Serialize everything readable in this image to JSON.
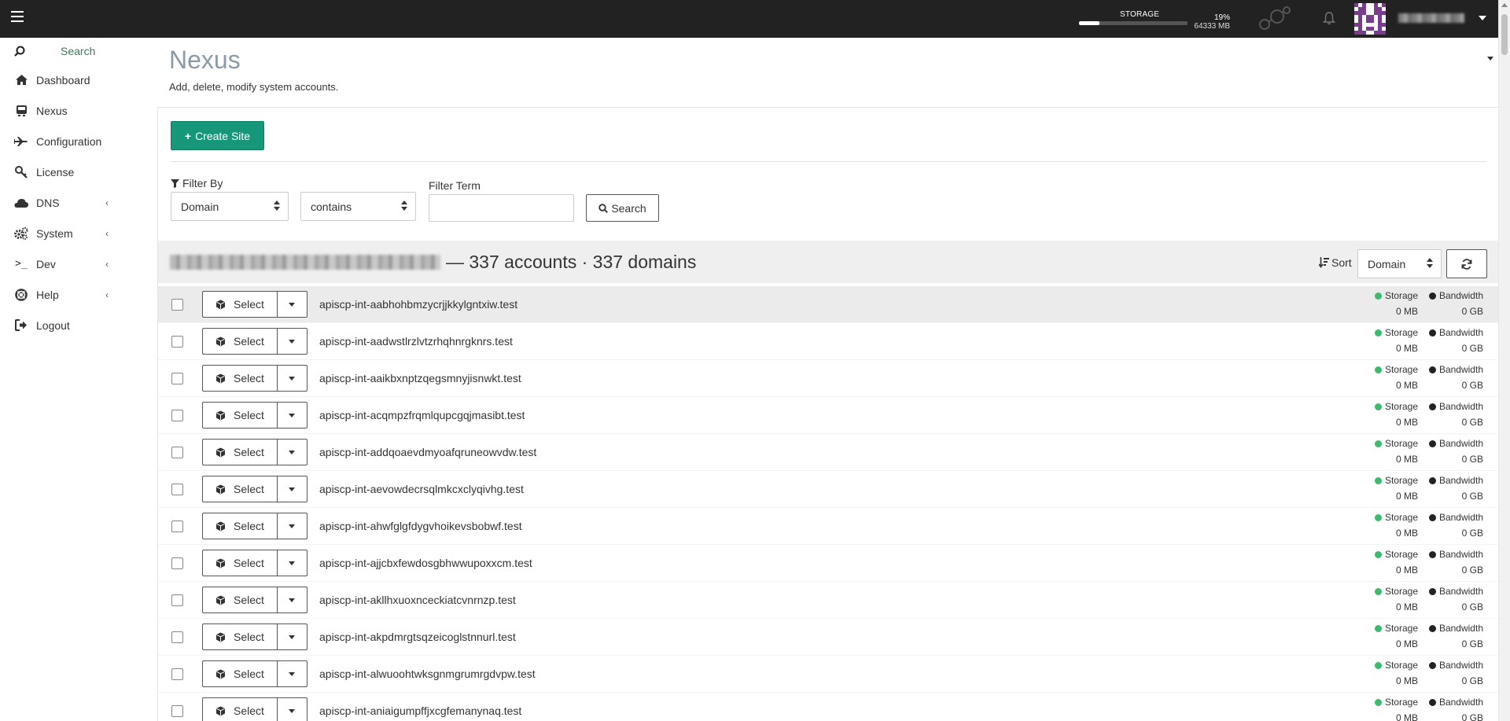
{
  "topbar": {
    "storage_label": "STORAGE",
    "storage_percent_text": "19%",
    "storage_used_text": "64333 MB",
    "storage_fraction": 0.19,
    "menu_icon": "hamburger-icon",
    "notifications_icon": "bell-icon"
  },
  "sidebar": {
    "search_label": "Search",
    "items": [
      {
        "label": "Dashboard",
        "icon": "home-icon",
        "expandable": false
      },
      {
        "label": "Nexus",
        "icon": "server-icon",
        "expandable": false
      },
      {
        "label": "Configuration",
        "icon": "plane-icon",
        "expandable": false
      },
      {
        "label": "License",
        "icon": "key-icon",
        "expandable": false
      },
      {
        "label": "DNS",
        "icon": "cloud-icon",
        "expandable": true
      },
      {
        "label": "System",
        "icon": "gears-icon",
        "expandable": true
      },
      {
        "label": "Dev",
        "icon": "terminal-icon",
        "expandable": true
      },
      {
        "label": "Help",
        "icon": "lifebuoy-icon",
        "expandable": true
      },
      {
        "label": "Logout",
        "icon": "sign-out-icon",
        "expandable": false
      }
    ]
  },
  "header": {
    "title": "Nexus",
    "subtitle": "Add, delete, modify system accounts."
  },
  "toolbar": {
    "create_label": "Create Site"
  },
  "filter": {
    "by_label": "Filter By",
    "field_value": "Domain",
    "op_value": "contains",
    "term_label": "Filter Term",
    "term_value": "",
    "search_label": "Search"
  },
  "summary": {
    "text": "— 337 accounts · 337 domains",
    "sort_label": "Sort",
    "sort_value": "Domain"
  },
  "metrics": {
    "storage_label": "Storage",
    "bandwidth_label": "Bandwidth",
    "storage_color": "#3cba6d",
    "bandwidth_color": "#222222"
  },
  "accounts": [
    {
      "domain": "apiscp-int-aabhohbmzycrjjkkylgntxiw.test",
      "storage": "0 MB",
      "bandwidth": "0 GB",
      "select_label": "Select"
    },
    {
      "domain": "apiscp-int-aadwstlrzlvtzrhqhnrgknrs.test",
      "storage": "0 MB",
      "bandwidth": "0 GB",
      "select_label": "Select"
    },
    {
      "domain": "apiscp-int-aaikbxnptzqegsmnyjisnwkt.test",
      "storage": "0 MB",
      "bandwidth": "0 GB",
      "select_label": "Select"
    },
    {
      "domain": "apiscp-int-acqmpzfrqmlqupcgqjmasibt.test",
      "storage": "0 MB",
      "bandwidth": "0 GB",
      "select_label": "Select"
    },
    {
      "domain": "apiscp-int-addqoaevdmyoafqruneowvdw.test",
      "storage": "0 MB",
      "bandwidth": "0 GB",
      "select_label": "Select"
    },
    {
      "domain": "apiscp-int-aevowdecrsqlmkcxclyqivhg.test",
      "storage": "0 MB",
      "bandwidth": "0 GB",
      "select_label": "Select"
    },
    {
      "domain": "apiscp-int-ahwfglgfdygvhoikevsbobwf.test",
      "storage": "0 MB",
      "bandwidth": "0 GB",
      "select_label": "Select"
    },
    {
      "domain": "apiscp-int-ajjcbxfewdosgbhwwupoxxcm.test",
      "storage": "0 MB",
      "bandwidth": "0 GB",
      "select_label": "Select"
    },
    {
      "domain": "apiscp-int-akllhxuoxnceckiatcvnrnzp.test",
      "storage": "0 MB",
      "bandwidth": "0 GB",
      "select_label": "Select"
    },
    {
      "domain": "apiscp-int-akpdmrgtsqzeicoglstnnurl.test",
      "storage": "0 MB",
      "bandwidth": "0 GB",
      "select_label": "Select"
    },
    {
      "domain": "apiscp-int-alwuoohtwksgnmgrumrgdvpw.test",
      "storage": "0 MB",
      "bandwidth": "0 GB",
      "select_label": "Select"
    },
    {
      "domain": "apiscp-int-aniaigumpffjxcgfemanynaq.test",
      "storage": "0 MB",
      "bandwidth": "0 GB",
      "select_label": "Select"
    }
  ]
}
